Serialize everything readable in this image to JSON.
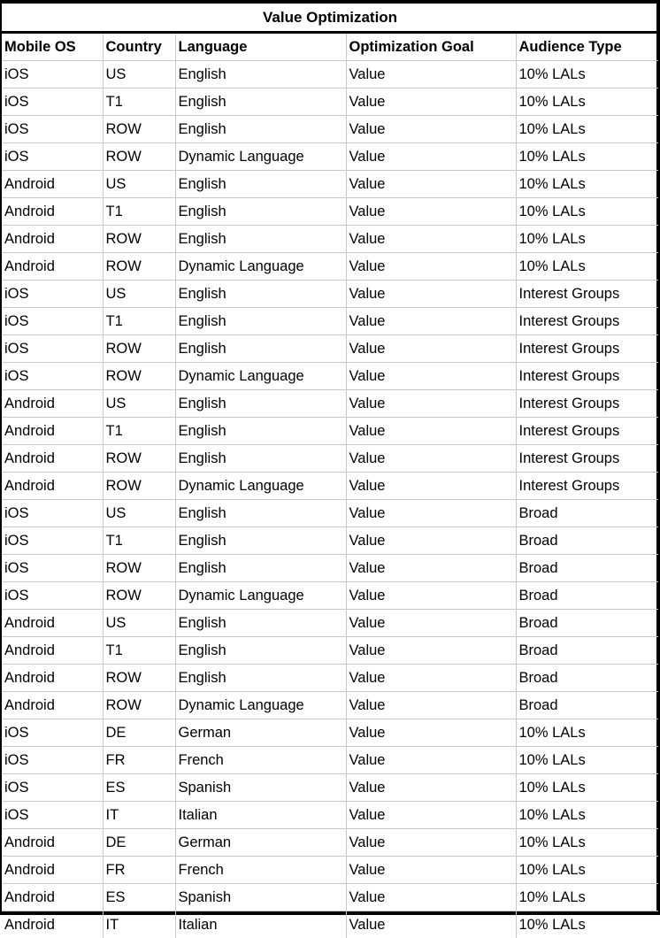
{
  "table": {
    "title": "Value Optimization",
    "columns": [
      "Mobile OS",
      "Country",
      "Language",
      "Optimization Goal",
      "Audience Type"
    ],
    "rows": [
      [
        "iOS",
        "US",
        "English",
        "Value",
        "10% LALs"
      ],
      [
        "iOS",
        "T1",
        "English",
        "Value",
        "10% LALs"
      ],
      [
        "iOS",
        "ROW",
        "English",
        "Value",
        "10% LALs"
      ],
      [
        "iOS",
        "ROW",
        "Dynamic Language",
        "Value",
        "10% LALs"
      ],
      [
        "Android",
        "US",
        "English",
        "Value",
        "10% LALs"
      ],
      [
        "Android",
        "T1",
        "English",
        "Value",
        "10% LALs"
      ],
      [
        "Android",
        "ROW",
        "English",
        "Value",
        "10% LALs"
      ],
      [
        "Android",
        "ROW",
        "Dynamic Language",
        "Value",
        "10% LALs"
      ],
      [
        "iOS",
        "US",
        "English",
        "Value",
        "Interest Groups"
      ],
      [
        "iOS",
        "T1",
        "English",
        "Value",
        "Interest Groups"
      ],
      [
        "iOS",
        "ROW",
        "English",
        "Value",
        "Interest Groups"
      ],
      [
        "iOS",
        "ROW",
        "Dynamic Language",
        "Value",
        "Interest Groups"
      ],
      [
        "Android",
        "US",
        "English",
        "Value",
        "Interest Groups"
      ],
      [
        "Android",
        "T1",
        "English",
        "Value",
        "Interest Groups"
      ],
      [
        "Android",
        "ROW",
        "English",
        "Value",
        "Interest Groups"
      ],
      [
        "Android",
        "ROW",
        "Dynamic Language",
        "Value",
        "Interest Groups"
      ],
      [
        "iOS",
        "US",
        "English",
        "Value",
        "Broad"
      ],
      [
        "iOS",
        "T1",
        "English",
        "Value",
        "Broad"
      ],
      [
        "iOS",
        "ROW",
        "English",
        "Value",
        "Broad"
      ],
      [
        "iOS",
        "ROW",
        "Dynamic Language",
        "Value",
        "Broad"
      ],
      [
        "Android",
        "US",
        "English",
        "Value",
        "Broad"
      ],
      [
        "Android",
        "T1",
        "English",
        "Value",
        "Broad"
      ],
      [
        "Android",
        "ROW",
        "English",
        "Value",
        "Broad"
      ],
      [
        "Android",
        "ROW",
        "Dynamic Language",
        "Value",
        "Broad"
      ],
      [
        "iOS",
        "DE",
        "German",
        "Value",
        "10% LALs"
      ],
      [
        "iOS",
        "FR",
        "French",
        "Value",
        "10% LALs"
      ],
      [
        "iOS",
        "ES",
        "Spanish",
        "Value",
        "10% LALs"
      ],
      [
        "iOS",
        "IT",
        "Italian",
        "Value",
        "10% LALs"
      ],
      [
        "Android",
        "DE",
        "German",
        "Value",
        "10% LALs"
      ],
      [
        "Android",
        "FR",
        "French",
        "Value",
        "10% LALs"
      ],
      [
        "Android",
        "ES",
        "Spanish",
        "Value",
        "10% LALs"
      ],
      [
        "Android",
        "IT",
        "Italian",
        "Value",
        "10% LALs"
      ]
    ],
    "colors": {
      "text": "#000000",
      "background": "#ffffff",
      "outer_border": "#000000",
      "grid_line": "#c8c8c8"
    }
  }
}
